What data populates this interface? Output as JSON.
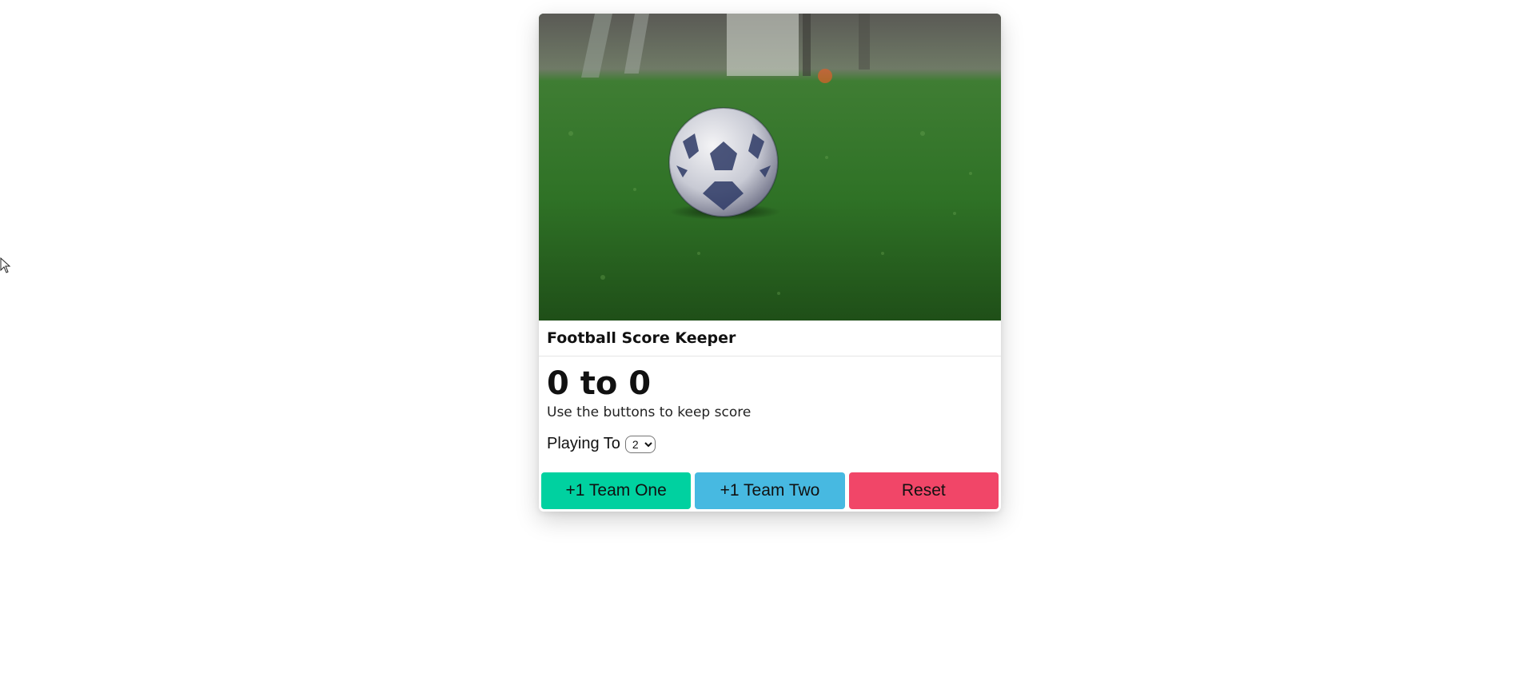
{
  "card": {
    "title": "Football Score Keeper",
    "image_alt": "soccer-ball-on-grass"
  },
  "score": {
    "team_one": 0,
    "team_two": 0,
    "display": "0 to 0",
    "subtitle": "Use the buttons to keep score"
  },
  "playing_to": {
    "label": "Playing To",
    "selected": "2"
  },
  "buttons": {
    "team_one": "+1 Team One",
    "team_two": "+1 Team Two",
    "reset": "Reset"
  },
  "colors": {
    "team_one": "#00d1a0",
    "team_two": "#47b9e1",
    "reset": "#f14668"
  },
  "icons": {
    "cursor": "mouse-pointer-icon",
    "select_caret": "chevron-down-icon"
  }
}
